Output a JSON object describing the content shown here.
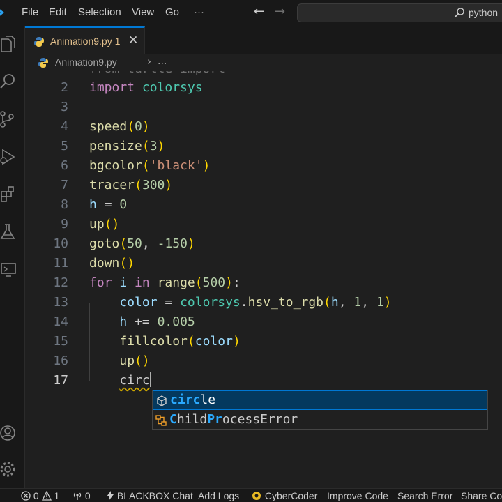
{
  "menu": {
    "file": "File",
    "edit": "Edit",
    "selection": "Selection",
    "view": "View",
    "go": "Go",
    "more": "···"
  },
  "nav": {
    "back": "←",
    "forward": "→"
  },
  "command_center": {
    "text": "python"
  },
  "activity_icons": [
    "explorer-icon",
    "search-icon",
    "source-control-icon",
    "run-debug-icon",
    "extensions-icon",
    "testing-icon",
    "remote-explorer-icon",
    "account-icon",
    "settings-gear-icon"
  ],
  "tab": {
    "label": "Animation9.py 1",
    "close": "✕"
  },
  "breadcrumb": {
    "file": "Animation9.py",
    "separator": "›",
    "more": "..."
  },
  "editor": {
    "partial_top_line": "from turtle import *",
    "line_numbers": [
      "2",
      "3",
      "4",
      "5",
      "6",
      "7",
      "8",
      "9",
      "10",
      "11",
      "12",
      "13",
      "14",
      "15",
      "16",
      "17"
    ],
    "current_line": "17",
    "tokens": {
      "import": "import",
      "colorsys": "colorsys",
      "speed": "speed",
      "zero": "0",
      "pensize": "pensize",
      "three": "3",
      "bgcolor": "bgcolor",
      "black": "'black'",
      "tracer": "tracer",
      "three_hundred": "300",
      "h": "h",
      "eq": "=",
      "up": "up",
      "goto": "goto",
      "fifty": "50",
      "neg150": "-150",
      "down": "down",
      "for": "for",
      "i": "i",
      "in": "in",
      "range": "range",
      "five_hundred": "500",
      "color": "color",
      "hsv_to_rgb": "hsv_to_rgb",
      "one": "1",
      "plus_eq": "+=",
      "inc": "0.005",
      "fillcolor": "fillcolor",
      "typed": "circ"
    }
  },
  "suggest": {
    "items": [
      {
        "match": "circ",
        "rest": "le",
        "icon": "method-cube-icon"
      },
      {
        "match": "C",
        "rest1": "hild",
        "match2": "Pr",
        "rest2": "ocessError",
        "icon": "class-icon"
      }
    ]
  },
  "status": {
    "errors": "0",
    "warnings": "1",
    "ports": "0",
    "blackbox": "BLACKBOX Chat",
    "add_logs": "Add Logs",
    "cybercoder": "CyberCoder",
    "improve": "Improve Code",
    "search_error": "Search Error",
    "share": "Share Cod"
  },
  "colors": {
    "accent": "#0078d4",
    "keyword": "#c586c0",
    "function": "#dcdcaa",
    "number": "#b5cea8",
    "string": "#ce9178",
    "highlight": "#2aaaff"
  }
}
